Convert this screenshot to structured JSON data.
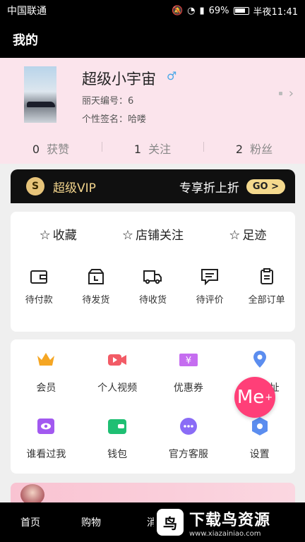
{
  "status_bar": {
    "carrier": "中国联通",
    "battery": "69%",
    "time": "半夜11:41"
  },
  "header": {
    "title": "我的"
  },
  "profile": {
    "nickname": "超级小宇宙",
    "gender_symbol": "♂",
    "id_label": "丽天编号：6",
    "signature": "个性签名：哈喽",
    "stats": [
      {
        "count": "0",
        "label": "获赞"
      },
      {
        "count": "1",
        "label": "关注"
      },
      {
        "count": "2",
        "label": "粉丝"
      }
    ]
  },
  "vip": {
    "badge": "S",
    "label": "超级VIP",
    "discount": "专享折上折",
    "go": "GO >"
  },
  "favorites": [
    {
      "label": "收藏"
    },
    {
      "label": "店铺关注"
    },
    {
      "label": "足迹"
    }
  ],
  "orders": [
    {
      "label": "待付款",
      "icon": "wallet-icon"
    },
    {
      "label": "待发货",
      "icon": "package-icon"
    },
    {
      "label": "待收货",
      "icon": "truck-icon"
    },
    {
      "label": "待评价",
      "icon": "comment-icon"
    },
    {
      "label": "全部订单",
      "icon": "clipboard-icon"
    }
  ],
  "services": [
    {
      "label": "会员",
      "icon": "crown-icon",
      "color": "#f5a623"
    },
    {
      "label": "个人视频",
      "icon": "video-icon",
      "color": "#f25b66"
    },
    {
      "label": "优惠券",
      "icon": "coupon-icon",
      "color": "#c56df0"
    },
    {
      "label": "收货地址",
      "icon": "location-icon",
      "color": "#5b8def"
    },
    {
      "label": "谁看过我",
      "icon": "eye-icon",
      "color": "#a259f0"
    },
    {
      "label": "钱包",
      "icon": "wallet-card-icon",
      "color": "#1fbf73"
    },
    {
      "label": "官方客服",
      "icon": "chat-icon",
      "color": "#8a6cf6"
    },
    {
      "label": "设置",
      "icon": "settings-icon",
      "color": "#5b8def"
    }
  ],
  "me_button": {
    "label": "Me",
    "plus": "+"
  },
  "tabs": [
    {
      "label": "首页"
    },
    {
      "label": "购物"
    },
    {
      "label": "消"
    }
  ],
  "watermark": {
    "title": "下载鸟资源",
    "url": "www.xiazainiao.com"
  }
}
